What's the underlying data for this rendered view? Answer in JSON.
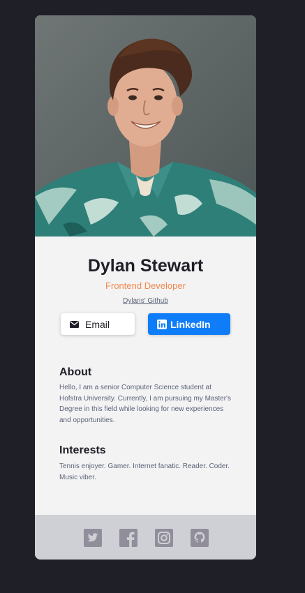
{
  "profile": {
    "name": "Dylan Stewart",
    "role": "Frontend Developer",
    "github_link": "Dylans' Github"
  },
  "buttons": {
    "email_label": "Email",
    "linkedin_label": "LinkedIn"
  },
  "about": {
    "title": "About",
    "text": "Hello, I am a senior Computer Science student at Hofstra University. Currently, I am pursuing my Master's Degree in this field while looking for new experiences and opportunities."
  },
  "interests": {
    "title": "Interests",
    "text": "Tennis enjoyer. Gamer. Internet fanatic. Reader. Coder. Music viber."
  },
  "footer": {
    "icons": [
      "twitter-icon",
      "facebook-icon",
      "instagram-icon",
      "github-icon"
    ]
  },
  "colors": {
    "background": "#1f1f27",
    "card": "#f3f3f4",
    "accent_orange": "#f3884f",
    "linkedin_blue": "#0f7df7",
    "footer": "#cfcfd6",
    "footer_icons": "#918e9b"
  }
}
